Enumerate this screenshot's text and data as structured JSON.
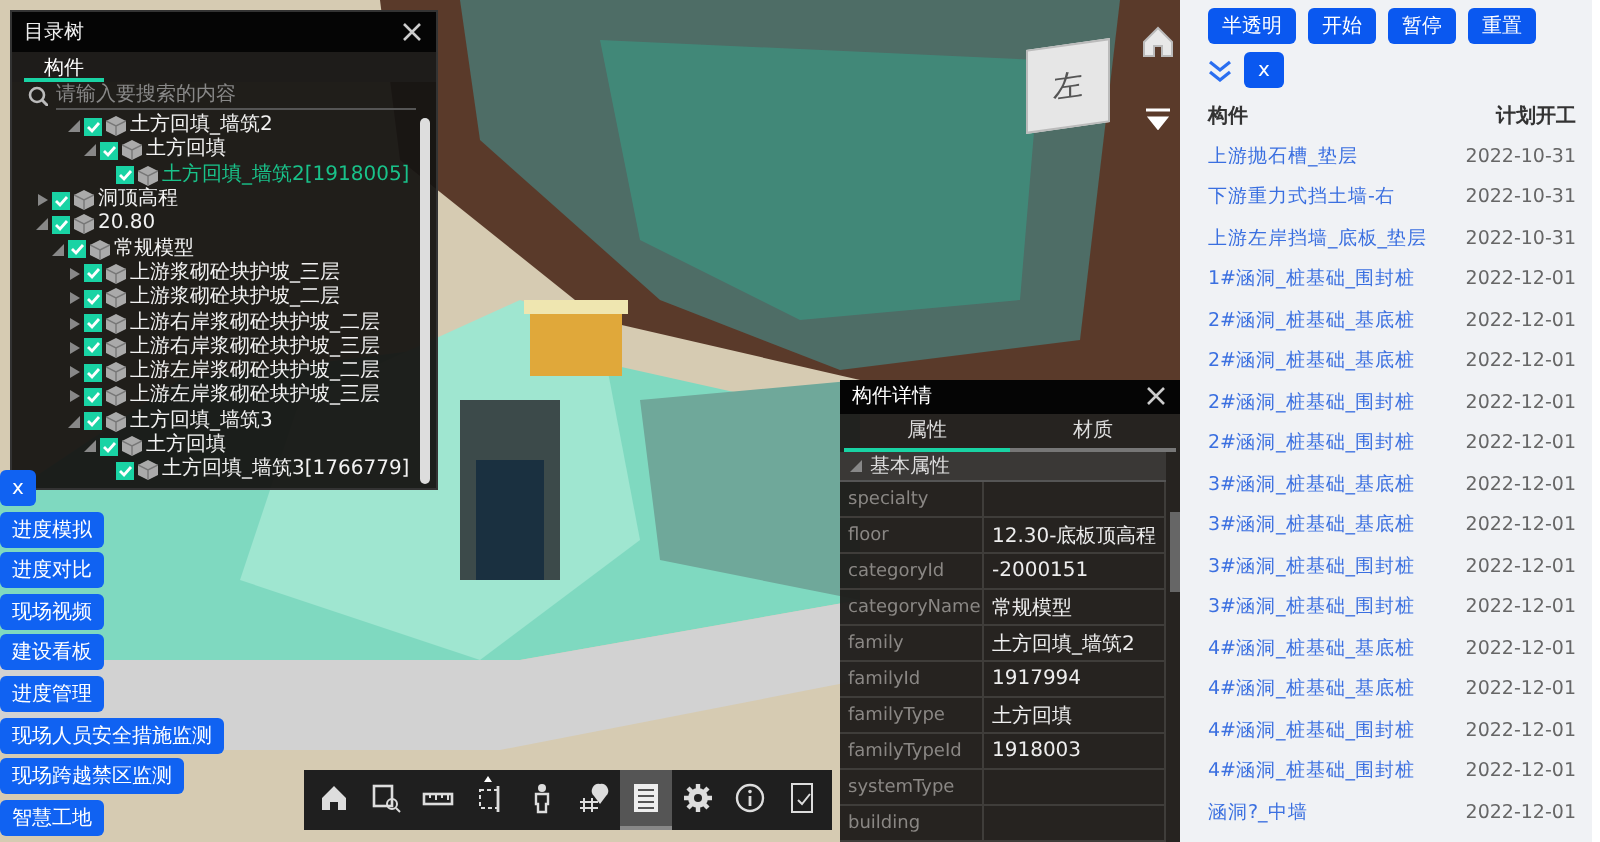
{
  "tree_panel": {
    "title": "目录树",
    "tabs": [
      {
        "label": "构件",
        "selected": true
      }
    ],
    "search": {
      "placeholder": "请输入要搜索的内容"
    },
    "items": [
      {
        "children": [
          {
            "children": [
              {
                "label": "土方回填_墙筑2",
                "checked": true,
                "expanded": true,
                "selected": false,
                "children": [
                  {
                    "label": "土方回填",
                    "checked": true,
                    "expanded": true,
                    "selected": false,
                    "children": [
                      {
                        "label": "土方回填_墙筑2[1918005]",
                        "checked": true,
                        "selected": true
                      }
                    ]
                  }
                ]
              }
            ]
          }
        ]
      },
      {
        "label": "洞顶高程",
        "checked": true,
        "expanded": false,
        "selected": false
      },
      {
        "label": "20.80",
        "checked": true,
        "expanded": true,
        "selected": false,
        "children": [
          {
            "label": "常规模型",
            "checked": true,
            "expanded": true,
            "selected": false,
            "children": [
              {
                "label": "上游浆砌砼块护坡_三层",
                "checked": true,
                "expanded": false,
                "selected": false
              },
              {
                "label": "上游浆砌砼块护坡_二层",
                "checked": true,
                "expanded": false,
                "selected": false
              },
              {
                "label": "上游右岸浆砌砼块护坡_二层",
                "checked": true,
                "expanded": false,
                "selected": false
              },
              {
                "label": "上游右岸浆砌砼块护坡_三层",
                "checked": true,
                "expanded": false,
                "selected": false
              },
              {
                "label": "上游左岸浆砌砼块护坡_二层",
                "checked": true,
                "expanded": false,
                "selected": false
              },
              {
                "label": "上游左岸浆砌砼块护坡_三层",
                "checked": true,
                "expanded": false,
                "selected": false
              },
              {
                "label": "土方回填_墙筑3",
                "checked": true,
                "expanded": true,
                "selected": false,
                "children": [
                  {
                    "label": "土方回填",
                    "checked": true,
                    "expanded": true,
                    "selected": false,
                    "children": [
                      {
                        "label": "土方回填_墙筑3[1766779]",
                        "checked": true,
                        "selected": false
                      }
                    ]
                  }
                ]
              }
            ]
          }
        ]
      }
    ]
  },
  "view_cube": {
    "label": "左"
  },
  "side_buttons": [
    "x",
    "进度模拟",
    "进度对比",
    "现场视频",
    "建设看板",
    "进度管理",
    "现场人员安全措施监测",
    "现场跨越禁区监测",
    "智慧工地"
  ],
  "toolbar": [
    {
      "kind": "home",
      "selected": false
    },
    {
      "kind": "zoom",
      "selected": false
    },
    {
      "kind": "measure",
      "selected": false
    },
    {
      "kind": "section",
      "selected": false
    },
    {
      "kind": "person",
      "selected": false
    },
    {
      "kind": "pin",
      "selected": false
    },
    {
      "kind": "list",
      "selected": true
    },
    {
      "kind": "settings",
      "selected": false
    },
    {
      "kind": "info",
      "selected": false
    },
    {
      "kind": "export",
      "selected": false
    }
  ],
  "detail_panel": {
    "title": "构件详情",
    "tabs": [
      {
        "label": "属性",
        "selected": true
      },
      {
        "label": "材质",
        "selected": false
      }
    ],
    "section": {
      "label": "基本属性",
      "expanded": true
    },
    "properties": [
      {
        "name": "specialty"
      },
      {
        "name": "floor",
        "value": "12.30-底板顶高程"
      },
      {
        "name": "categoryId",
        "value": "-2000151"
      },
      {
        "name": "categoryName",
        "value": "常规模型"
      },
      {
        "name": "family",
        "value": "土方回填_墙筑2"
      },
      {
        "name": "familyId",
        "value": "1917994"
      },
      {
        "name": "familyType",
        "value": "土方回填"
      },
      {
        "name": "familyTypeId",
        "value": "1918003"
      },
      {
        "name": "systemType"
      },
      {
        "name": "building"
      }
    ]
  },
  "schedule_panel": {
    "buttons": [
      "半透明",
      "开始",
      "暂停",
      "重置"
    ],
    "close_button": "x",
    "table": {
      "columns": [
        "构件",
        "计划开工"
      ],
      "rows": [
        [
          "上游抛石槽_垫层",
          "2022-10-31"
        ],
        [
          "下游重力式挡土墙-右",
          "2022-10-31"
        ],
        [
          "上游左岸挡墙_底板_垫层",
          "2022-10-31"
        ],
        [
          "1#涵洞_桩基础_围封桩",
          "2022-12-01"
        ],
        [
          "2#涵洞_桩基础_基底桩",
          "2022-12-01"
        ],
        [
          "2#涵洞_桩基础_基底桩",
          "2022-12-01"
        ],
        [
          "2#涵洞_桩基础_围封桩",
          "2022-12-01"
        ],
        [
          "2#涵洞_桩基础_围封桩",
          "2022-12-01"
        ],
        [
          "3#涵洞_桩基础_基底桩",
          "2022-12-01"
        ],
        [
          "3#涵洞_桩基础_基底桩",
          "2022-12-01"
        ],
        [
          "3#涵洞_桩基础_围封桩",
          "2022-12-01"
        ],
        [
          "3#涵洞_桩基础_围封桩",
          "2022-12-01"
        ],
        [
          "4#涵洞_桩基础_基底桩",
          "2022-12-01"
        ],
        [
          "4#涵洞_桩基础_基底桩",
          "2022-12-01"
        ],
        [
          "4#涵洞_桩基础_围封桩",
          "2022-12-01"
        ],
        [
          "4#涵洞_桩基础_围封桩",
          "2022-12-01"
        ],
        [
          "涵洞?_中墙",
          "2022-12-01"
        ]
      ]
    }
  }
}
